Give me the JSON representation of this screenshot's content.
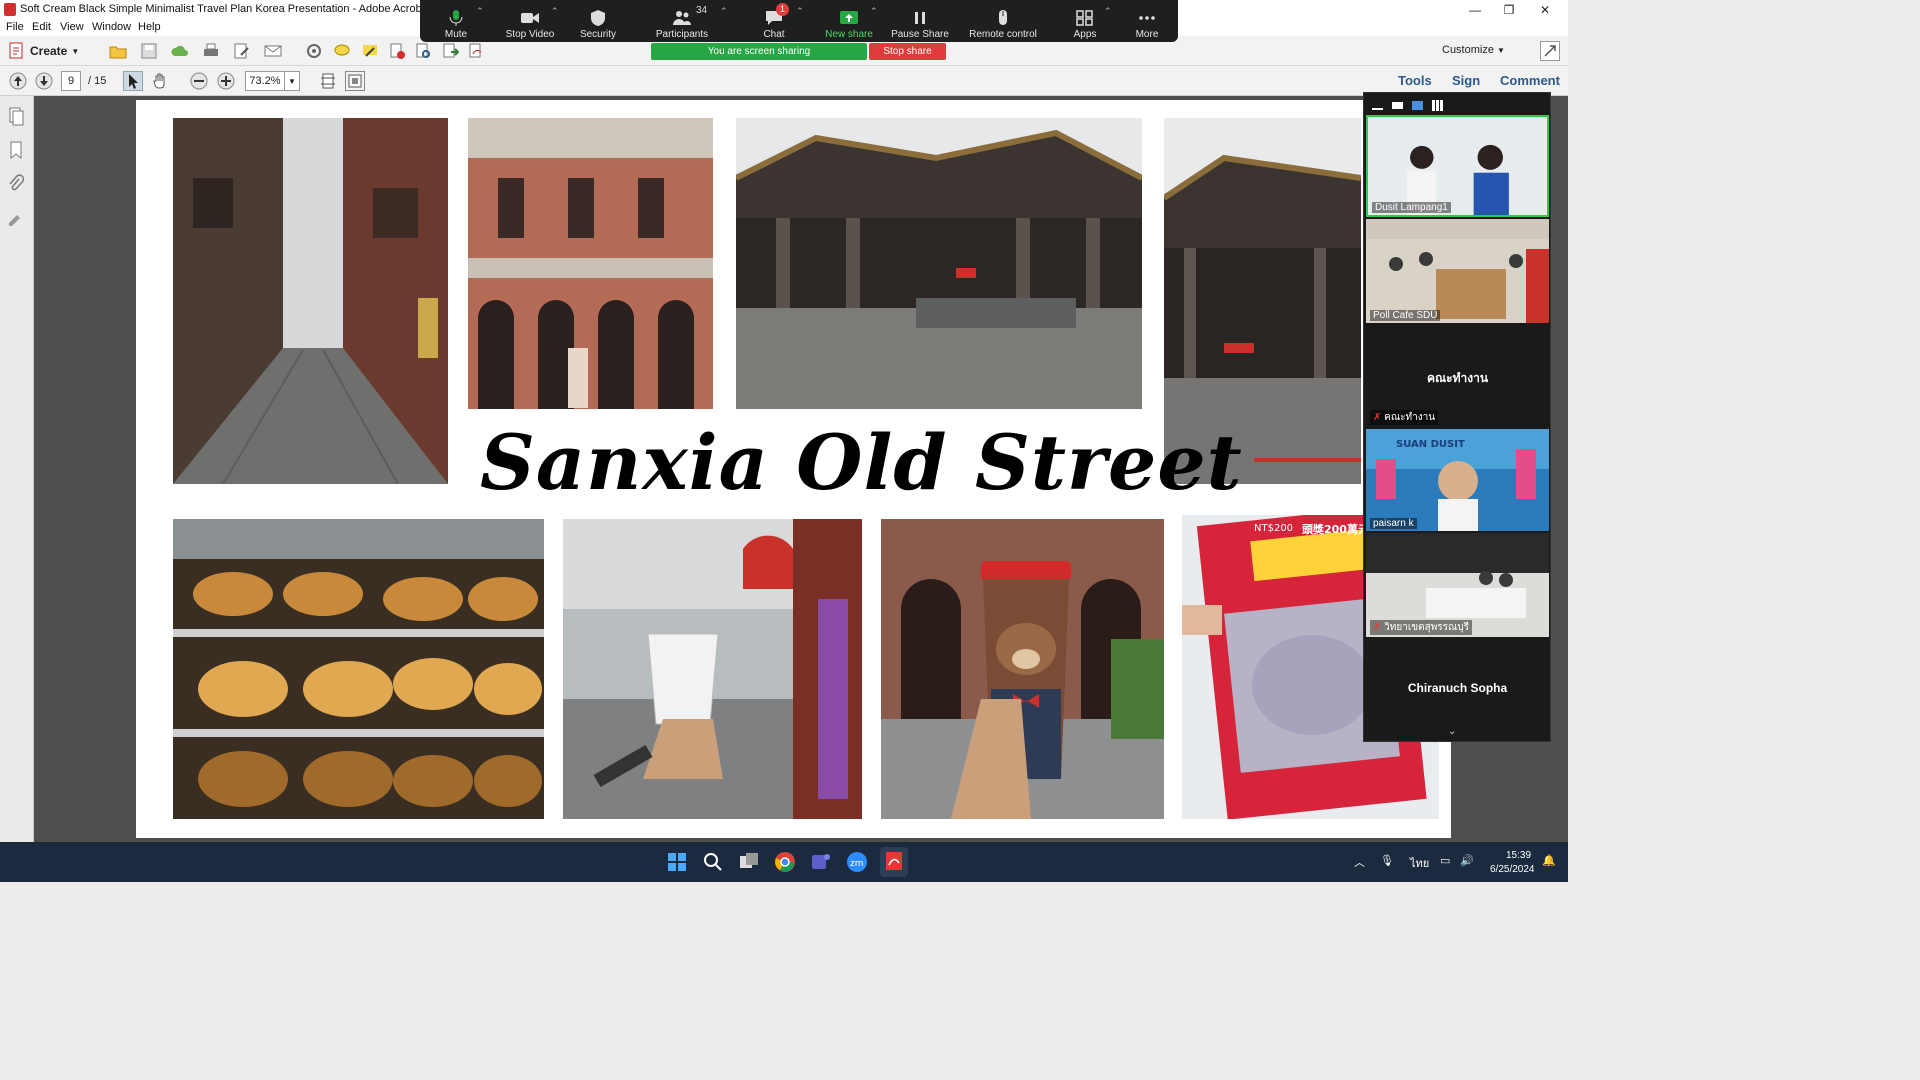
{
  "window": {
    "title": "Soft Cream Black Simple Minimalist Travel Plan Korea Presentation - Adobe Acrobat Pro",
    "minimize": "—",
    "maximize": "❐",
    "close": "✕"
  },
  "menu": [
    "File",
    "Edit",
    "View",
    "Window",
    "Help"
  ],
  "toolbar": {
    "create_label": "Create",
    "customize_label": "Customize"
  },
  "nav": {
    "page_current": "9",
    "page_total": "/ 15",
    "zoom_value": "73.2%"
  },
  "right_panel_links": [
    "Tools",
    "Sign",
    "Comment"
  ],
  "slide": {
    "title": "Sanxia Old Street"
  },
  "zoom_controls": {
    "mute": "Mute",
    "stop_video": "Stop Video",
    "security": "Security",
    "participants": "Participants",
    "participants_count": "34",
    "chat": "Chat",
    "chat_badge": "1",
    "new_share": "New share",
    "pause_share": "Pause Share",
    "remote_control": "Remote control",
    "apps": "Apps",
    "more": "More",
    "sharing_banner": "You are screen sharing",
    "stop_share": "Stop share"
  },
  "participants": [
    {
      "name": "Dusit Lampang1"
    },
    {
      "name": "Poll Cafe SDU"
    },
    {
      "name": "คณะทำงาน",
      "label": "คณะทำงาน"
    },
    {
      "name": "paisarn k",
      "overlay": "SUAN DUSIT"
    },
    {
      "name": "วิทยาเขตสุพรรณบุรี"
    },
    {
      "name": "Chiranuch Sopha"
    }
  ],
  "taskbar": {
    "time": "15:39",
    "date": "6/25/2024",
    "lang": "ไทย"
  },
  "photo_text": {
    "ticket_price": "NT$200",
    "ticket_prize": "頭獎200萬元"
  },
  "colors": {
    "zoom_green": "#27a844",
    "zoom_red": "#e23b3b",
    "acrobat_link": "#2b5a8a",
    "taskbar": "#1c2a3f"
  }
}
